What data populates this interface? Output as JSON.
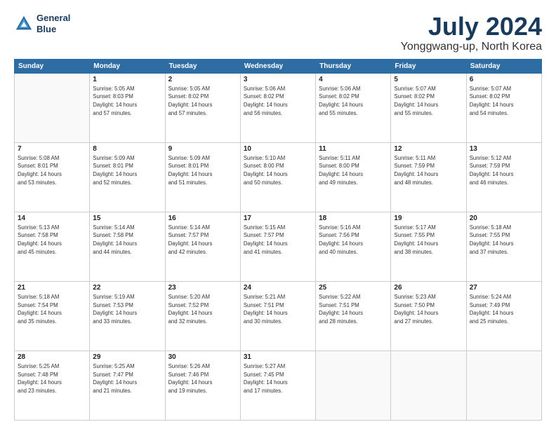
{
  "logo": {
    "line1": "General",
    "line2": "Blue"
  },
  "title": "July 2024",
  "subtitle": "Yonggwang-up, North Korea",
  "header_days": [
    "Sunday",
    "Monday",
    "Tuesday",
    "Wednesday",
    "Thursday",
    "Friday",
    "Saturday"
  ],
  "weeks": [
    [
      {
        "day": "",
        "sunrise": "",
        "sunset": "",
        "daylight": ""
      },
      {
        "day": "1",
        "sunrise": "Sunrise: 5:05 AM",
        "sunset": "Sunset: 8:03 PM",
        "daylight": "Daylight: 14 hours and 57 minutes."
      },
      {
        "day": "2",
        "sunrise": "Sunrise: 5:05 AM",
        "sunset": "Sunset: 8:02 PM",
        "daylight": "Daylight: 14 hours and 57 minutes."
      },
      {
        "day": "3",
        "sunrise": "Sunrise: 5:06 AM",
        "sunset": "Sunset: 8:02 PM",
        "daylight": "Daylight: 14 hours and 56 minutes."
      },
      {
        "day": "4",
        "sunrise": "Sunrise: 5:06 AM",
        "sunset": "Sunset: 8:02 PM",
        "daylight": "Daylight: 14 hours and 55 minutes."
      },
      {
        "day": "5",
        "sunrise": "Sunrise: 5:07 AM",
        "sunset": "Sunset: 8:02 PM",
        "daylight": "Daylight: 14 hours and 55 minutes."
      },
      {
        "day": "6",
        "sunrise": "Sunrise: 5:07 AM",
        "sunset": "Sunset: 8:02 PM",
        "daylight": "Daylight: 14 hours and 54 minutes."
      }
    ],
    [
      {
        "day": "7",
        "sunrise": "Sunrise: 5:08 AM",
        "sunset": "Sunset: 8:01 PM",
        "daylight": "Daylight: 14 hours and 53 minutes."
      },
      {
        "day": "8",
        "sunrise": "Sunrise: 5:09 AM",
        "sunset": "Sunset: 8:01 PM",
        "daylight": "Daylight: 14 hours and 52 minutes."
      },
      {
        "day": "9",
        "sunrise": "Sunrise: 5:09 AM",
        "sunset": "Sunset: 8:01 PM",
        "daylight": "Daylight: 14 hours and 51 minutes."
      },
      {
        "day": "10",
        "sunrise": "Sunrise: 5:10 AM",
        "sunset": "Sunset: 8:00 PM",
        "daylight": "Daylight: 14 hours and 50 minutes."
      },
      {
        "day": "11",
        "sunrise": "Sunrise: 5:11 AM",
        "sunset": "Sunset: 8:00 PM",
        "daylight": "Daylight: 14 hours and 49 minutes."
      },
      {
        "day": "12",
        "sunrise": "Sunrise: 5:11 AM",
        "sunset": "Sunset: 7:59 PM",
        "daylight": "Daylight: 14 hours and 48 minutes."
      },
      {
        "day": "13",
        "sunrise": "Sunrise: 5:12 AM",
        "sunset": "Sunset: 7:59 PM",
        "daylight": "Daylight: 14 hours and 46 minutes."
      }
    ],
    [
      {
        "day": "14",
        "sunrise": "Sunrise: 5:13 AM",
        "sunset": "Sunset: 7:58 PM",
        "daylight": "Daylight: 14 hours and 45 minutes."
      },
      {
        "day": "15",
        "sunrise": "Sunrise: 5:14 AM",
        "sunset": "Sunset: 7:58 PM",
        "daylight": "Daylight: 14 hours and 44 minutes."
      },
      {
        "day": "16",
        "sunrise": "Sunrise: 5:14 AM",
        "sunset": "Sunset: 7:57 PM",
        "daylight": "Daylight: 14 hours and 42 minutes."
      },
      {
        "day": "17",
        "sunrise": "Sunrise: 5:15 AM",
        "sunset": "Sunset: 7:57 PM",
        "daylight": "Daylight: 14 hours and 41 minutes."
      },
      {
        "day": "18",
        "sunrise": "Sunrise: 5:16 AM",
        "sunset": "Sunset: 7:56 PM",
        "daylight": "Daylight: 14 hours and 40 minutes."
      },
      {
        "day": "19",
        "sunrise": "Sunrise: 5:17 AM",
        "sunset": "Sunset: 7:55 PM",
        "daylight": "Daylight: 14 hours and 38 minutes."
      },
      {
        "day": "20",
        "sunrise": "Sunrise: 5:18 AM",
        "sunset": "Sunset: 7:55 PM",
        "daylight": "Daylight: 14 hours and 37 minutes."
      }
    ],
    [
      {
        "day": "21",
        "sunrise": "Sunrise: 5:18 AM",
        "sunset": "Sunset: 7:54 PM",
        "daylight": "Daylight: 14 hours and 35 minutes."
      },
      {
        "day": "22",
        "sunrise": "Sunrise: 5:19 AM",
        "sunset": "Sunset: 7:53 PM",
        "daylight": "Daylight: 14 hours and 33 minutes."
      },
      {
        "day": "23",
        "sunrise": "Sunrise: 5:20 AM",
        "sunset": "Sunset: 7:52 PM",
        "daylight": "Daylight: 14 hours and 32 minutes."
      },
      {
        "day": "24",
        "sunrise": "Sunrise: 5:21 AM",
        "sunset": "Sunset: 7:51 PM",
        "daylight": "Daylight: 14 hours and 30 minutes."
      },
      {
        "day": "25",
        "sunrise": "Sunrise: 5:22 AM",
        "sunset": "Sunset: 7:51 PM",
        "daylight": "Daylight: 14 hours and 28 minutes."
      },
      {
        "day": "26",
        "sunrise": "Sunrise: 5:23 AM",
        "sunset": "Sunset: 7:50 PM",
        "daylight": "Daylight: 14 hours and 27 minutes."
      },
      {
        "day": "27",
        "sunrise": "Sunrise: 5:24 AM",
        "sunset": "Sunset: 7:49 PM",
        "daylight": "Daylight: 14 hours and 25 minutes."
      }
    ],
    [
      {
        "day": "28",
        "sunrise": "Sunrise: 5:25 AM",
        "sunset": "Sunset: 7:48 PM",
        "daylight": "Daylight: 14 hours and 23 minutes."
      },
      {
        "day": "29",
        "sunrise": "Sunrise: 5:25 AM",
        "sunset": "Sunset: 7:47 PM",
        "daylight": "Daylight: 14 hours and 21 minutes."
      },
      {
        "day": "30",
        "sunrise": "Sunrise: 5:26 AM",
        "sunset": "Sunset: 7:46 PM",
        "daylight": "Daylight: 14 hours and 19 minutes."
      },
      {
        "day": "31",
        "sunrise": "Sunrise: 5:27 AM",
        "sunset": "Sunset: 7:45 PM",
        "daylight": "Daylight: 14 hours and 17 minutes."
      },
      {
        "day": "",
        "sunrise": "",
        "sunset": "",
        "daylight": ""
      },
      {
        "day": "",
        "sunrise": "",
        "sunset": "",
        "daylight": ""
      },
      {
        "day": "",
        "sunrise": "",
        "sunset": "",
        "daylight": ""
      }
    ]
  ]
}
